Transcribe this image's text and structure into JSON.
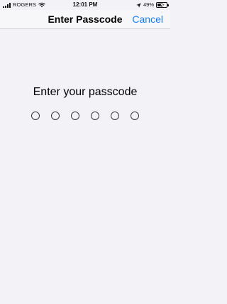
{
  "status_bar": {
    "carrier": "ROGERS",
    "time": "12:01 PM",
    "battery_percent": "49%",
    "battery_level": 0.49,
    "icons": [
      "signal-icon",
      "wifi-icon",
      "location-arrow-icon",
      "battery-charging-icon"
    ]
  },
  "nav": {
    "title": "Enter Passcode",
    "cancel_label": "Cancel"
  },
  "content": {
    "prompt": "Enter your passcode",
    "passcode_length": 6,
    "entered_digits": 0
  },
  "colors": {
    "background": "#f2f2f7",
    "accent": "#1a7cf5",
    "text": "#000000",
    "dot_border": "#3a3a3c"
  }
}
